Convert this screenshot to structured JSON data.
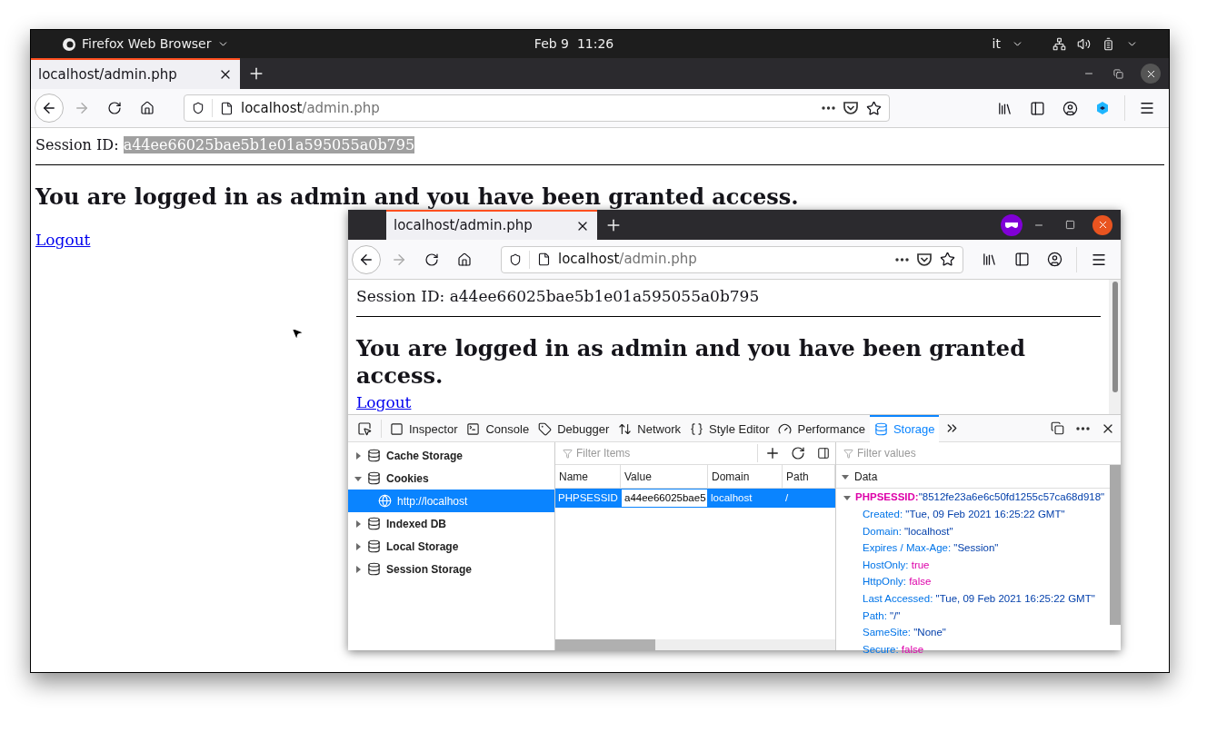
{
  "top_bar": {
    "app_menu": "Firefox Web Browser",
    "clock": "Feb 9  11:26",
    "keyboard_layout": "it"
  },
  "browser": {
    "tabs": [
      {
        "title": "localhost/admin.php",
        "selected": true
      }
    ],
    "url": {
      "host": "localhost",
      "path": "/admin.php"
    },
    "page": {
      "session_label": "Session ID:",
      "session_id": "a44ee66025bae5b1e01a595055a0b795",
      "session_id_highlighted": true,
      "heading": "You are logged in as admin and you have been granted access.",
      "link": "Logout"
    }
  },
  "inner_window": {
    "tabs": [
      {
        "title": "localhost/admin.php",
        "selected": true
      }
    ],
    "private": true,
    "url": {
      "host": "localhost",
      "path": "/admin.php"
    },
    "page": {
      "session_label": "Session ID:",
      "session_id": "a44ee66025bae5b1e01a595055a0b795",
      "session_id_highlighted": false,
      "heading": "You are logged in as admin and you have been granted access.",
      "link": "Logout"
    },
    "devtools": {
      "tools": [
        {
          "label": "Inspector",
          "kind": "inspector",
          "selected": false
        },
        {
          "label": "Console",
          "kind": "console",
          "selected": false
        },
        {
          "label": "Debugger",
          "kind": "debugger",
          "selected": false
        },
        {
          "label": "Network",
          "kind": "network",
          "selected": false
        },
        {
          "label": "Style Editor",
          "kind": "style",
          "selected": false
        },
        {
          "label": "Performance",
          "kind": "performance",
          "selected": false
        },
        {
          "label": "Storage",
          "kind": "storage",
          "selected": true
        }
      ],
      "sidebar": {
        "items": [
          {
            "label": "Cache Storage",
            "expanded": false
          },
          {
            "label": "Cookies",
            "expanded": true,
            "children": [
              {
                "label": "http://localhost",
                "selected": true
              }
            ]
          },
          {
            "label": "Indexed DB",
            "expanded": false
          },
          {
            "label": "Local Storage",
            "expanded": false
          },
          {
            "label": "Session Storage",
            "expanded": false
          }
        ]
      },
      "filter_placeholder": "Filter Items",
      "table": {
        "columns": [
          "Name",
          "Value",
          "Domain",
          "Path"
        ],
        "rows": [
          {
            "selected": true,
            "cells": [
              {
                "text": "PHPSESSID",
                "editing": false
              },
              {
                "text": "a44ee66025bae5",
                "editing": true
              },
              {
                "text": "localhost",
                "editing": false
              },
              {
                "text": "/",
                "editing": false
              }
            ]
          }
        ]
      },
      "data_panel": {
        "filter_placeholder": "Filter values",
        "heading": "Data",
        "cookie": {
          "name": "PHPSESSID:",
          "value": "\"8512fe23a6e6c50fd1255c57ca68d918\"",
          "expanded": true,
          "properties": [
            {
              "key": "Created:",
              "value": "\"Tue, 09 Feb 2021 16:25:22 GMT\"",
              "kind": "string"
            },
            {
              "key": "Domain:",
              "value": "\"localhost\"",
              "kind": "string"
            },
            {
              "key": "Expires / Max-Age:",
              "value": "\"Session\"",
              "kind": "string"
            },
            {
              "key": "HostOnly:",
              "value": "true",
              "kind": "boolean"
            },
            {
              "key": "HttpOnly:",
              "value": "false",
              "kind": "boolean"
            },
            {
              "key": "Last Accessed:",
              "value": "\"Tue, 09 Feb 2021 16:25:22 GMT\"",
              "kind": "string"
            },
            {
              "key": "Path:",
              "value": "\"/\"",
              "kind": "string"
            },
            {
              "key": "SameSite:",
              "value": "\"None\"",
              "kind": "string"
            },
            {
              "key": "Secure:",
              "value": "false",
              "kind": "boolean"
            }
          ]
        }
      }
    }
  }
}
